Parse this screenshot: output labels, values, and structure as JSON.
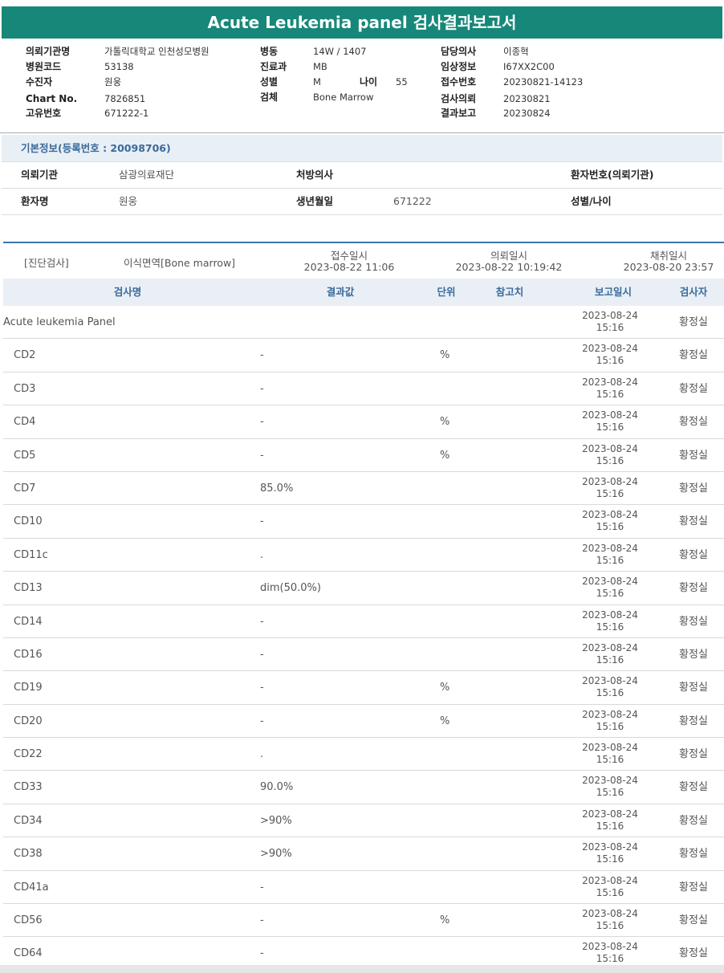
{
  "title": "Acute Leukemia panel 검사결과보고서",
  "header": {
    "col1": [
      {
        "label": "의뢰기관명",
        "value": "가톨릭대학교 인천성모병원"
      },
      {
        "label": "병원코드",
        "value": "53138"
      },
      {
        "label": "수진자",
        "value": "원웅"
      },
      {
        "label": "Chart No.",
        "value": "7826851"
      },
      {
        "label": "고유번호",
        "value": "671222-1"
      }
    ],
    "col2": [
      {
        "label": "병동",
        "value": "14W / 1407"
      },
      {
        "label": "진료과",
        "value": "MB"
      },
      {
        "label": "성별",
        "value": "M"
      },
      {
        "label": "검체",
        "value": "Bone Marrow"
      }
    ],
    "age": {
      "label": "나이",
      "value": "55"
    },
    "col3": [
      {
        "label": "담당의사",
        "value": "이종혁"
      },
      {
        "label": "임상정보",
        "value": "I67XX2C00"
      },
      {
        "label": "접수번호",
        "value": "20230821-14123"
      },
      {
        "label": "검사의뢰",
        "value": "20230821"
      },
      {
        "label": "결과보고",
        "value": "20230824"
      }
    ]
  },
  "basic_info": {
    "heading": "기본정보(등록번호 : 20098706)",
    "row1": {
      "org_label": "의뢰기관",
      "org_value": "삼광의료재단",
      "doctor_label": "처방의사",
      "doctor_value": "",
      "patno_label": "환자번호(의뢰기관)",
      "patno_value": ""
    },
    "row2": {
      "name_label": "환자명",
      "name_value": "원웅",
      "birth_label": "생년월일",
      "birth_value": "671222",
      "sexage_label": "성별/나이",
      "sexage_value": ""
    }
  },
  "test_info": {
    "category": "[진단검사]",
    "test": "이식면역[Bone marrow]",
    "received_label": "접수일시",
    "received_value": "2023-08-22 11:06",
    "requested_label": "의뢰일시",
    "requested_value": "2023-08-22 10:19:42",
    "collected_label": "채취일시",
    "collected_value": "2023-08-20 23:57"
  },
  "columns": {
    "name": "검사명",
    "result": "결과값",
    "unit": "단위",
    "ref": "참고치",
    "report_date": "보고일시",
    "inspector": "검사자"
  },
  "results": [
    {
      "name": "Acute leukemia Panel",
      "result": "",
      "unit": "",
      "date": "2023-08-24",
      "time": "15:16",
      "inspector": "황정실",
      "group": true
    },
    {
      "name": "CD2",
      "result": "-",
      "unit": "%",
      "date": "2023-08-24",
      "time": "15:16",
      "inspector": "황정실"
    },
    {
      "name": "CD3",
      "result": "-",
      "unit": "",
      "date": "2023-08-24",
      "time": "15:16",
      "inspector": "황정실"
    },
    {
      "name": "CD4",
      "result": "-",
      "unit": "%",
      "date": "2023-08-24",
      "time": "15:16",
      "inspector": "황정실"
    },
    {
      "name": "CD5",
      "result": "-",
      "unit": "%",
      "date": "2023-08-24",
      "time": "15:16",
      "inspector": "황정실"
    },
    {
      "name": "CD7",
      "result": "85.0%",
      "unit": "",
      "date": "2023-08-24",
      "time": "15:16",
      "inspector": "황정실"
    },
    {
      "name": "CD10",
      "result": "-",
      "unit": "",
      "date": "2023-08-24",
      "time": "15:16",
      "inspector": "황정실"
    },
    {
      "name": "CD11c",
      "result": ".",
      "unit": "",
      "date": "2023-08-24",
      "time": "15:16",
      "inspector": "황정실"
    },
    {
      "name": "CD13",
      "result": "dim(50.0%)",
      "unit": "",
      "date": "2023-08-24",
      "time": "15:16",
      "inspector": "황정실"
    },
    {
      "name": "CD14",
      "result": "-",
      "unit": "",
      "date": "2023-08-24",
      "time": "15:16",
      "inspector": "황정실"
    },
    {
      "name": "CD16",
      "result": "-",
      "unit": "",
      "date": "2023-08-24",
      "time": "15:16",
      "inspector": "황정실"
    },
    {
      "name": "CD19",
      "result": "-",
      "unit": "%",
      "date": "2023-08-24",
      "time": "15:16",
      "inspector": "황정실"
    },
    {
      "name": "CD20",
      "result": "-",
      "unit": "%",
      "date": "2023-08-24",
      "time": "15:16",
      "inspector": "황정실"
    },
    {
      "name": "CD22",
      "result": ".",
      "unit": "",
      "date": "2023-08-24",
      "time": "15:16",
      "inspector": "황정실"
    },
    {
      "name": "CD33",
      "result": "90.0%",
      "unit": "",
      "date": "2023-08-24",
      "time": "15:16",
      "inspector": "황정실"
    },
    {
      "name": "CD34",
      "result": ">90%",
      "unit": "",
      "date": "2023-08-24",
      "time": "15:16",
      "inspector": "황정실"
    },
    {
      "name": "CD38",
      "result": ">90%",
      "unit": "",
      "date": "2023-08-24",
      "time": "15:16",
      "inspector": "황정실"
    },
    {
      "name": "CD41a",
      "result": "-",
      "unit": "",
      "date": "2023-08-24",
      "time": "15:16",
      "inspector": "황정실"
    },
    {
      "name": "CD56",
      "result": "-",
      "unit": "%",
      "date": "2023-08-24",
      "time": "15:16",
      "inspector": "황정실"
    },
    {
      "name": "CD64",
      "result": "-",
      "unit": "",
      "date": "2023-08-24",
      "time": "15:16",
      "inspector": "황정실"
    }
  ]
}
